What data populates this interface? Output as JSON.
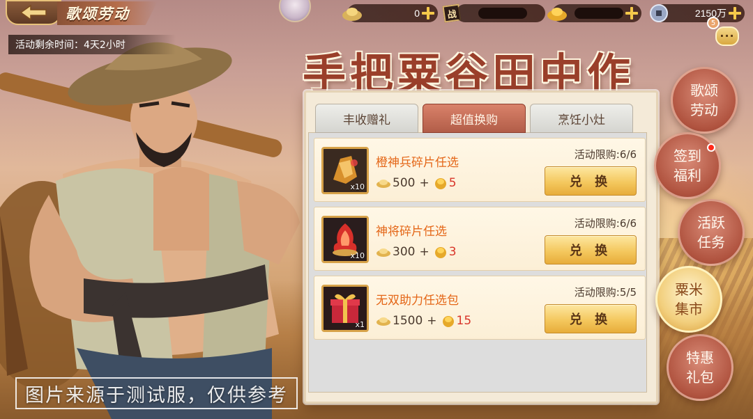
{
  "header": {
    "title": "歌颂劳动",
    "timer_label": "活动剩余时间：4天2小时"
  },
  "resources": [
    {
      "name": "silver-ingot",
      "value": "0"
    },
    {
      "name": "battle-power",
      "badge": "战",
      "value": ""
    },
    {
      "name": "gold-ingot",
      "value": ""
    },
    {
      "name": "copper-coin",
      "value": "2150万"
    }
  ],
  "chat": {
    "count": "5",
    "icon": "chat-bubble-icon"
  },
  "headline": "手把粟谷田中作",
  "tabs": [
    {
      "label": "丰收赠礼",
      "active": false
    },
    {
      "label": "超值换购",
      "active": true
    },
    {
      "label": "烹饪小灶",
      "active": false
    }
  ],
  "items": [
    {
      "name": "橙神兵碎片任选",
      "qty": "x10",
      "cost_a": "500",
      "cost_b": "5",
      "limit": "活动限购:6/6",
      "button": "兑 换",
      "icon": "weapon-shard-icon"
    },
    {
      "name": "神将碎片任选",
      "qty": "x10",
      "cost_a": "300",
      "cost_b": "3",
      "limit": "活动限购:6/6",
      "button": "兑 换",
      "icon": "general-shard-icon"
    },
    {
      "name": "无双助力任选包",
      "qty": "x1",
      "cost_a": "1500",
      "cost_b": "15",
      "limit": "活动限购:5/5",
      "button": "兑 换",
      "icon": "gift-box-icon"
    }
  ],
  "cost_plus": "+",
  "side_menu": [
    {
      "label": "歌颂劳动",
      "active": false,
      "dot": false
    },
    {
      "label": "签到福利",
      "active": false,
      "dot": true
    },
    {
      "label": "活跃任务",
      "active": false,
      "dot": false
    },
    {
      "label": "粟米集市",
      "active": true,
      "dot": false
    },
    {
      "label": "特惠礼包",
      "active": false,
      "dot": false
    }
  ],
  "watermark": "图片来源于测试服，仅供参考",
  "colors": {
    "accent_orange": "#e46617",
    "price_red": "#d8352a",
    "headline": "#9a3f2a",
    "active_tab": "#b25d48"
  }
}
